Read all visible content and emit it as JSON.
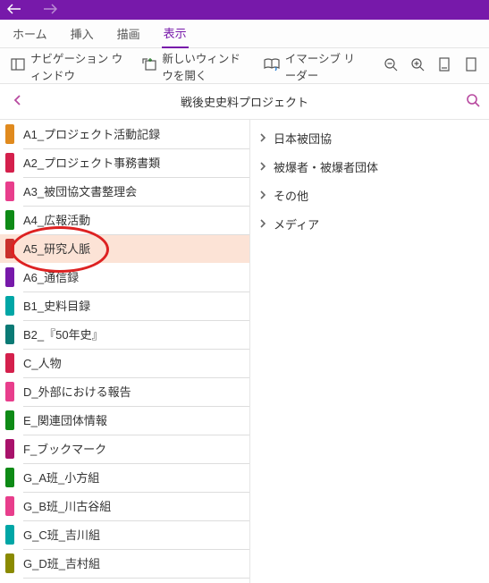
{
  "tabs": {
    "home": "ホーム",
    "insert": "挿入",
    "draw": "描画",
    "view": "表示"
  },
  "toolbar": {
    "nav": "ナビゲーション ウィンドウ",
    "newwin": "新しいウィンドウを開く",
    "immersive": "イマーシブ リーダー"
  },
  "header": {
    "title": "戦後史史料プロジェクト"
  },
  "notebooks": [
    {
      "label": "A1_プロジェクト活動記録",
      "color": "#e08a1e"
    },
    {
      "label": "A2_プロジェクト事務書類",
      "color": "#d4204c"
    },
    {
      "label": "A3_被団協文書整理会",
      "color": "#e83e8c"
    },
    {
      "label": "A4_広報活動",
      "color": "#0e8a16"
    },
    {
      "label": "A5_研究人脈",
      "color": "#c9302c",
      "selected": true
    },
    {
      "label": "A6_通信録",
      "color": "#7719aa"
    },
    {
      "label": "B1_史料目録",
      "color": "#00a6a6"
    },
    {
      "label": "B2_『50年史』",
      "color": "#0b7a75"
    },
    {
      "label": "C_人物",
      "color": "#d4204c"
    },
    {
      "label": "D_外部における報告",
      "color": "#e83e8c"
    },
    {
      "label": "E_関連団体情報",
      "color": "#0e8a16"
    },
    {
      "label": "F_ブックマーク",
      "color": "#a8126b"
    },
    {
      "label": "G_A班_小方組",
      "color": "#0e8a16"
    },
    {
      "label": "G_B班_川古谷組",
      "color": "#e83e8c"
    },
    {
      "label": "G_C班_吉川組",
      "color": "#00a6a6"
    },
    {
      "label": "G_D班_吉村組",
      "color": "#8a8a00"
    }
  ],
  "sections": [
    {
      "label": "日本被団協"
    },
    {
      "label": "被爆者・被爆者団体"
    },
    {
      "label": "その他"
    },
    {
      "label": "メディア"
    }
  ],
  "annotation": {
    "ellipse_target": "A5_研究人脈"
  }
}
